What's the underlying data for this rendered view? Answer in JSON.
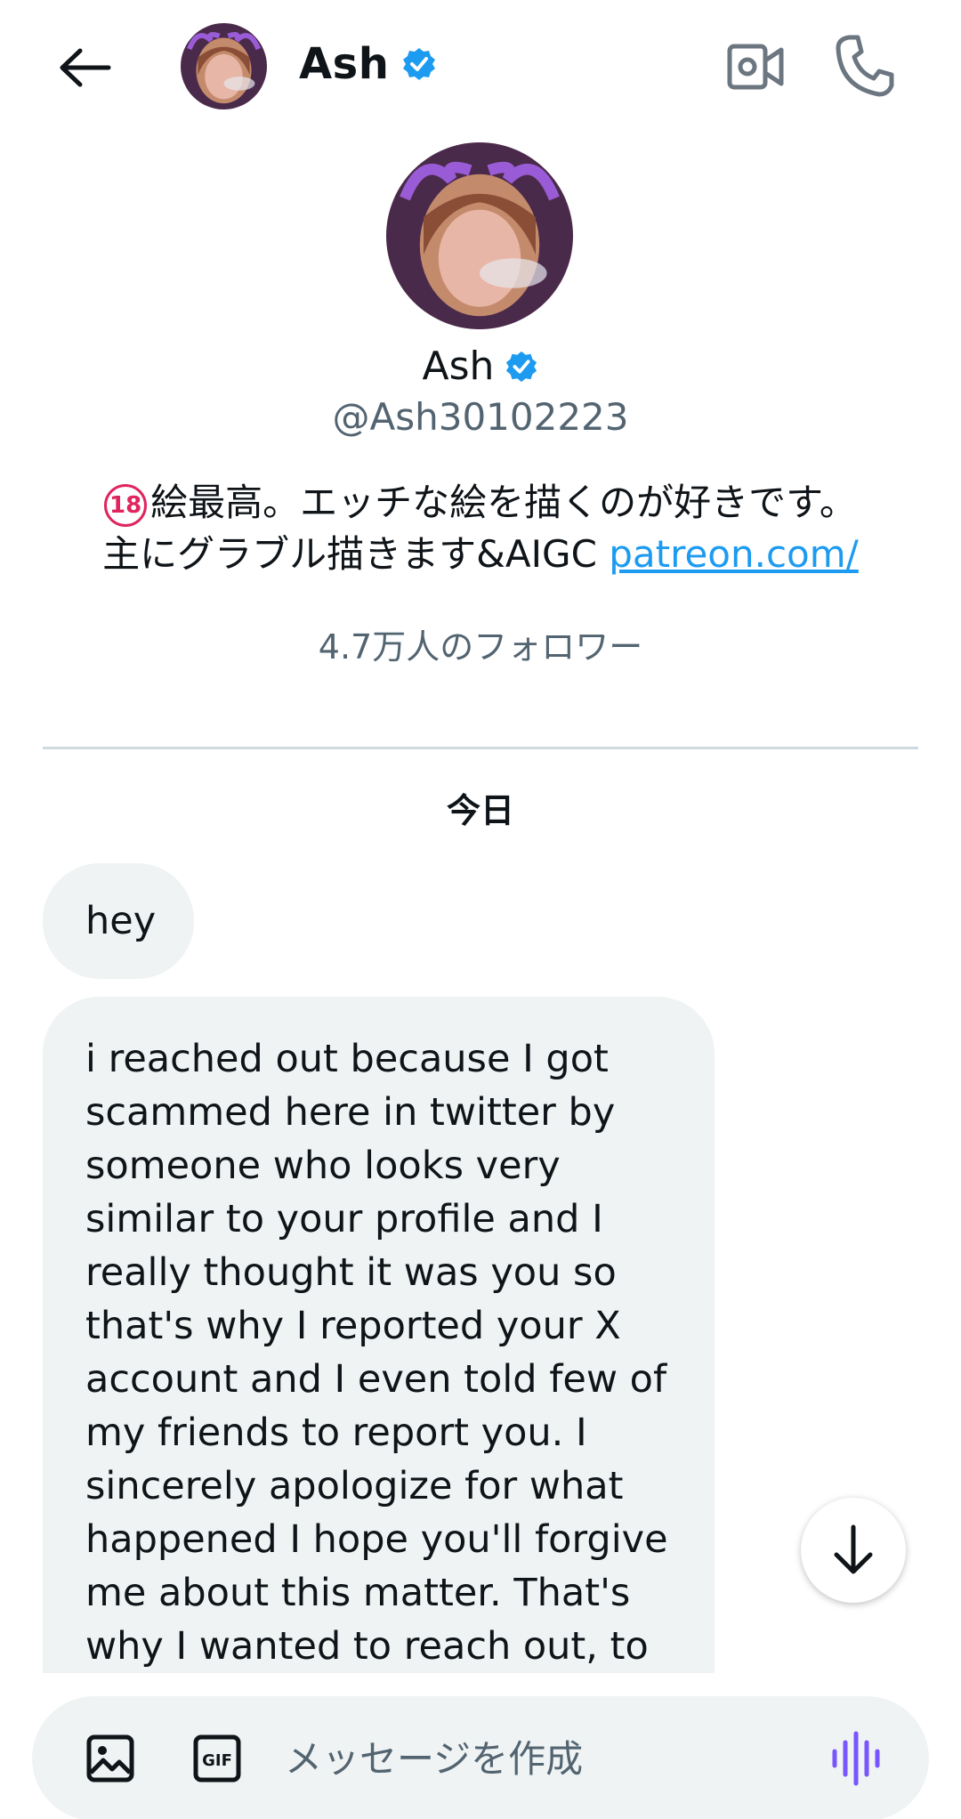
{
  "header": {
    "name": "Ash",
    "icons": {
      "back": "arrow-left-icon",
      "verified": "verified-badge-icon",
      "video": "video-camera-icon",
      "phone": "phone-icon"
    }
  },
  "profile": {
    "name": "Ash",
    "handle": "@Ash30102223",
    "bio_badge": "18",
    "bio_line1": "絵最高。エッチな絵を描くのが好きです。",
    "bio_line2": "主にグラブル描きます&AIGC ",
    "bio_link": "patreon.com/",
    "followers": "4.7万人のフォロワー"
  },
  "conversation": {
    "date_label": "今日",
    "messages": [
      {
        "text": "hey"
      },
      {
        "text": "i  reached out because I got scammed here in twitter by someone who looks very similar to your profile and I really thought it was you so that's why I reported your X account and I even told few of my friends to report you. I sincerely apologize for what happened I hope you'll forgive me about this matter. That's why I wanted to reach out, to check what the X official"
      }
    ]
  },
  "composer": {
    "placeholder": "メッセージを作成",
    "icons": {
      "media": "image-icon",
      "gif": "gif-icon",
      "voice": "voice-waveform-icon"
    }
  },
  "colors": {
    "accent": "#1d9bf0",
    "bubble": "#eff3f4",
    "secondary_text": "#536471",
    "voice": "#7856ff",
    "age_badge": "#e0245e"
  }
}
